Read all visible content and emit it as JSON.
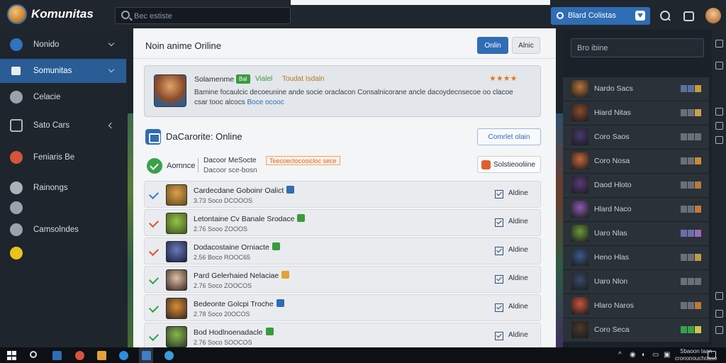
{
  "app": {
    "name": "Komunitas"
  },
  "search": {
    "placeholder": "Bec estiste"
  },
  "top_action": {
    "label": "Blard Colistas"
  },
  "sidebar": {
    "items": [
      {
        "label": "Nonido",
        "icon": "compass-icon",
        "caret": "down"
      },
      {
        "label": "Somunitas",
        "icon": "puzzle-icon",
        "caret": "down",
        "active": true
      },
      {
        "label": "Celacie",
        "icon": "group-icon"
      },
      {
        "label": "Sato Cars",
        "icon": "box-icon",
        "caret": "left"
      },
      {
        "label": "Feniaris Be",
        "icon": "fire-icon"
      },
      {
        "label": "Rainongs",
        "icon": "gear-icon"
      },
      {
        "label": "",
        "icon": "globe-icon"
      },
      {
        "label": "Camsolndes",
        "icon": "pin-icon"
      },
      {
        "label": "",
        "icon": "star-icon"
      }
    ]
  },
  "main": {
    "title": "Noin anime Oriline",
    "primary_button": "Onlin",
    "secondary_button": "Alnic",
    "featured": {
      "title": "Solamenme",
      "tag": "Bal",
      "tag2": "Vialel",
      "subtitle": "Toudat Isdaln",
      "rating": "★★★★",
      "description": "Bamine focaulcic decoeunine ande socie oraclacon Consalnicorane ancle dacoydecnsecoe oo clacoe csar tooc alcocs",
      "link": "Boce ocooc"
    },
    "section": {
      "title": "DaCarorite: Online",
      "button": "Comrlet olain"
    },
    "filter": {
      "label": "Aomnce",
      "name": "Dacoor MeSocte",
      "sub": "Dacoor sce-bosn",
      "hint": "Teecoectocosicloc sece",
      "button": "Solstieooliine"
    },
    "rows": [
      {
        "title": "Cardecdane Goboinr Oalict",
        "meta": "3.73 Soco  DCOOOS",
        "action": "Aldine",
        "check": "#3d7fc8",
        "badge": "#2f6db5"
      },
      {
        "title": "Letontaine Cv Banale  Srodace",
        "meta": "2.76 Sooo  ZOOOS",
        "action": "Aldine",
        "check": "#d9533b",
        "badge": "#3a9a3f"
      },
      {
        "title": "Dodacostaine Orniacte",
        "meta": "2.56 Boco  ROOC65",
        "action": "Aldine",
        "check": "#d9533b",
        "badge": "#3a9a3f"
      },
      {
        "title": "Pard Gelerhaied  Nelaciae",
        "meta": "2.76 Soco  ZOOCOS",
        "action": "Aldine",
        "check": "#3aa14a",
        "badge": "#e4a13a"
      },
      {
        "title": "Bedeonte Golcpi  Troche",
        "meta": "2.78 Soco  20OCOS",
        "action": "Aldine",
        "check": "#3aa14a",
        "badge": "#2f6db5"
      },
      {
        "title": "Bod Hodlnoenadacle",
        "meta": "2.76 Soco  SOOCOS",
        "action": "Aldine",
        "check": "#3aa14a",
        "badge": "#3a9a3f"
      }
    ]
  },
  "right": {
    "search_placeholder": "Bro ibine",
    "items": [
      {
        "label": "Nardo Sacs",
        "thumb": "#b5763a",
        "sq": [
          "#5c6fa0",
          "#5c6fa0",
          "#c99a3c"
        ]
      },
      {
        "label": "Hiard Nitas",
        "thumb": "#8a4a2e",
        "sq": [
          "#6b7078",
          "#6b7078",
          "#c9a24a"
        ]
      },
      {
        "label": "Coro Saos",
        "thumb": "#4a3a6e",
        "sq": [
          "#6b7078",
          "#6b7078",
          "#6b7078"
        ]
      },
      {
        "label": "Coro Nosa",
        "thumb": "#c6673a",
        "sq": [
          "#6b7078",
          "#6b7078",
          "#c98a3a"
        ]
      },
      {
        "label": "Daod Hloto",
        "thumb": "#5a3a7a",
        "sq": [
          "#6b7078",
          "#6b7078",
          "#b97a3a"
        ]
      },
      {
        "label": "Hlard Naco",
        "thumb": "#8a5ab0",
        "sq": [
          "#6b7078",
          "#6b7078",
          "#c07a3a"
        ]
      },
      {
        "label": "Uaro Nlas",
        "thumb": "#6a9a3a",
        "sq": [
          "#6b6fa8",
          "#6b6fa8",
          "#9a6ab8"
        ]
      },
      {
        "label": "Heno Hlas",
        "thumb": "#3a5a8a",
        "sq": [
          "#6b7078",
          "#6b7078",
          "#c09a4a"
        ]
      },
      {
        "label": "Uaro Nlon",
        "thumb": "#3a4a6a",
        "sq": [
          "#6b7078",
          "#6b7078",
          "#6b7078"
        ]
      },
      {
        "label": "Hlaro Naros",
        "thumb": "#c9553a",
        "sq": [
          "#6b7078",
          "#6b7078",
          "#b97a3a"
        ]
      },
      {
        "label": "Coro Seca",
        "thumb": "#4a3a2a",
        "sq": [
          "#3aa14a",
          "#3aa14a",
          "#c9c94a"
        ]
      }
    ]
  },
  "taskbar": {
    "clock_time": "Sbaoon laan",
    "clock_date": "crononouchoaso"
  }
}
